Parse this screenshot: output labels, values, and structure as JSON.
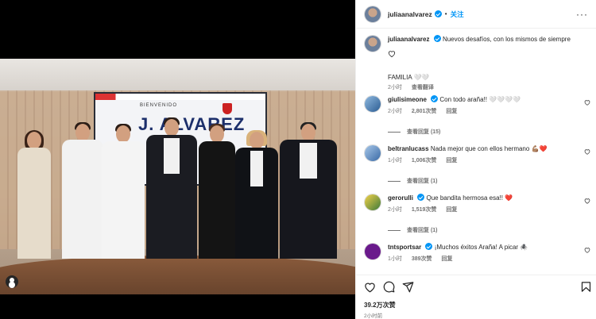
{
  "post": {
    "author": "juliaanalvarez",
    "follow_label": "关注",
    "separator": "•",
    "more_label": "···",
    "caption": "Nuevos desafíos, con los mismos de siempre",
    "caption_line2": "FAMILIA 🤍🤍",
    "caption_time": "2小时",
    "translate_label": "查看翻译",
    "screen_welcome": "BIENVENIDO",
    "screen_name": "J. ALVAREZ"
  },
  "comments": [
    {
      "user": "giulisimeone",
      "text": "Con todo araña!! 🤍🤍🤍🤍",
      "time": "2小时",
      "likes": "2,801次赞",
      "reply": "回复",
      "replies": "查看回复 (15)"
    },
    {
      "user": "beltranlucass",
      "text": "Nada mejor que con ellos hermano 💪🏽❤️",
      "time": "1小时",
      "likes": "1,006次赞",
      "reply": "回复",
      "replies": "查看回复 (1)"
    },
    {
      "user": "gerorulli",
      "text": "Que bandita hermosa esa!! ❤️",
      "time": "2小时",
      "likes": "1,519次赞",
      "reply": "回复",
      "replies": "查看回复 (1)"
    },
    {
      "user": "tntsportsar",
      "text": "¡Muchos éxitos Araña! A picar 🕷️",
      "time": "1小时",
      "likes": "389次赞",
      "reply": "回复",
      "replies": ""
    }
  ],
  "footer": {
    "likes": "39.2万次赞",
    "time": "2小时前"
  },
  "icons": {
    "like": "heart-icon",
    "comment": "comment-icon",
    "share": "share-icon",
    "save": "bookmark-icon",
    "tag": "user-tag-icon"
  },
  "colors": {
    "verified": "#0095f6",
    "link": "#0095f6",
    "muted": "#737373",
    "text": "#262626"
  }
}
